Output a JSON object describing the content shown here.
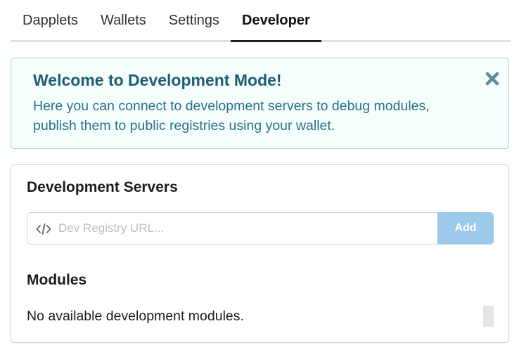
{
  "tabs": [
    {
      "label": "Dapplets",
      "active": false
    },
    {
      "label": "Wallets",
      "active": false
    },
    {
      "label": "Settings",
      "active": false
    },
    {
      "label": "Developer",
      "active": true
    }
  ],
  "welcome": {
    "title": "Welcome to Development Mode!",
    "text_line1": "Here you can connect to development servers to debug modules,",
    "text_line2": "publish them to public registries using your wallet.",
    "close_icon": "close-icon"
  },
  "servers": {
    "heading": "Development Servers",
    "input_icon": "code-icon",
    "input_placeholder": "Dev Registry URL...",
    "input_value": "",
    "add_label": "Add"
  },
  "modules": {
    "heading": "Modules",
    "empty_text": "No available development modules."
  },
  "colors": {
    "message_bg": "#f5fdfd",
    "message_border": "#a9d5de",
    "message_title": "#1f5d70",
    "message_text": "#2a7188",
    "add_button_bg": "#9dc9ea"
  }
}
